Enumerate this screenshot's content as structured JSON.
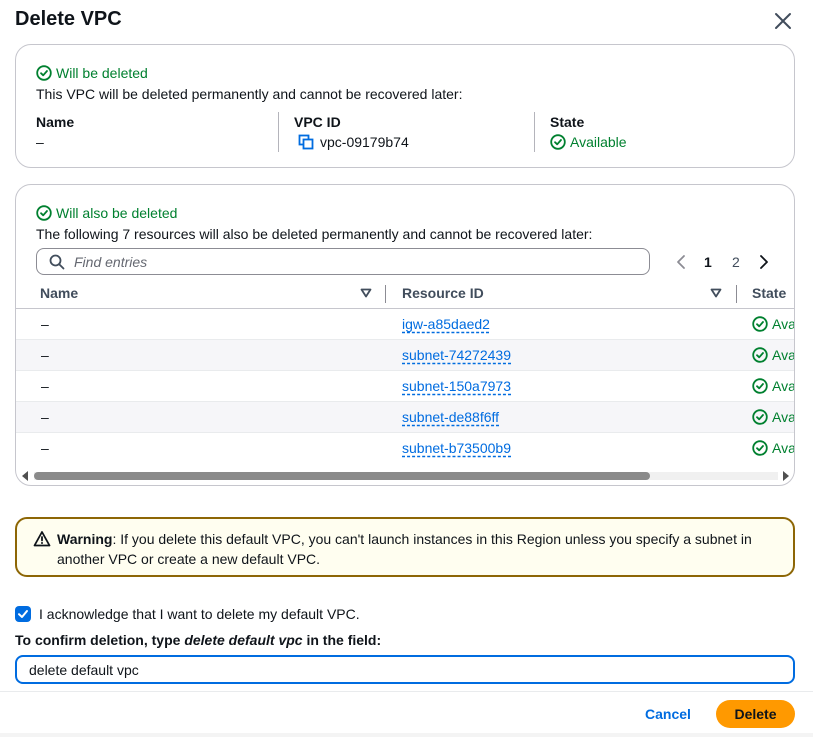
{
  "dialog": {
    "title": "Delete VPC",
    "close_icon": "close-icon"
  },
  "vpc_card": {
    "status": "Will be deleted",
    "description": "This VPC will be deleted permanently and cannot be recovered later:",
    "name_label": "Name",
    "name_value": "–",
    "vpc_id_label": "VPC ID",
    "vpc_id_value": "vpc-09179b74",
    "state_label": "State",
    "state_value": "Available"
  },
  "resources_card": {
    "status": "Will also be deleted",
    "description": "The following 7 resources will also be deleted permanently and cannot be recovered later:",
    "search_placeholder": "Find entries",
    "pagination": {
      "current": "1",
      "next": "2"
    },
    "columns": {
      "name": "Name",
      "resource_id": "Resource ID",
      "state": "State"
    },
    "rows": [
      {
        "name": "–",
        "resource_id": "igw-a85daed2",
        "state": "Ava"
      },
      {
        "name": "–",
        "resource_id": "subnet-74272439",
        "state": "Ava"
      },
      {
        "name": "–",
        "resource_id": "subnet-150a7973",
        "state": "Ava"
      },
      {
        "name": "–",
        "resource_id": "subnet-de88f6ff",
        "state": "Ava"
      },
      {
        "name": "–",
        "resource_id": "subnet-b73500b9",
        "state": "Ava"
      }
    ]
  },
  "warning": {
    "label": "Warning",
    "text": ": If you delete this default VPC, you can't launch instances in this Region unless you specify a subnet in another VPC or create a new default VPC."
  },
  "acknowledge": {
    "checked": true,
    "label": "I acknowledge that I want to delete my default VPC."
  },
  "confirm": {
    "label_prefix": "To confirm deletion, type ",
    "label_phrase": "delete default vpc",
    "label_suffix": " in the field:",
    "value": "delete default vpc"
  },
  "footer": {
    "cancel_label": "Cancel",
    "delete_label": "Delete"
  },
  "colors": {
    "success": "#00802f",
    "link": "#006ce0",
    "primary_button": "#ff9900",
    "warning_border": "#8d6605",
    "warning_bg": "#fffef0"
  }
}
